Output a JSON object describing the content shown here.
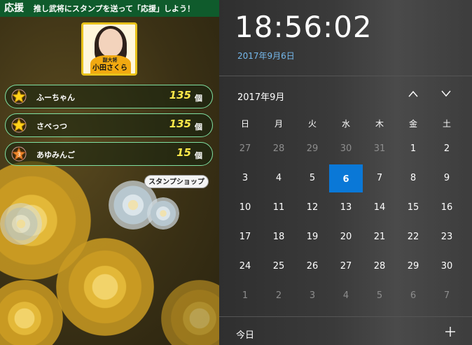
{
  "game": {
    "header_title": "応援",
    "header_subtitle": "推し武将にスタンプを送って「応援」しよう！",
    "portrait": {
      "role": "副大将",
      "name": "小田さくら"
    },
    "ranking": [
      {
        "badge": "gold-star",
        "name": "ふーちゃん",
        "count": "135",
        "unit": "個"
      },
      {
        "badge": "gold-star",
        "name": "さべっつ",
        "count": "135",
        "unit": "個"
      },
      {
        "badge": "orange-star-3",
        "name": "あゆみんご",
        "count": "15",
        "unit": "個"
      }
    ],
    "shop_button": "スタンプショップ"
  },
  "clock": {
    "time": "18:56:02",
    "date": "2017年9月6日",
    "month_label": "2017年9月",
    "weekdays": [
      "日",
      "月",
      "火",
      "水",
      "木",
      "金",
      "土"
    ],
    "weeks": [
      [
        "27",
        "28",
        "29",
        "30",
        "31",
        "1",
        "2"
      ],
      [
        "3",
        "4",
        "5",
        "6",
        "7",
        "8",
        "9"
      ],
      [
        "10",
        "11",
        "12",
        "13",
        "14",
        "15",
        "16"
      ],
      [
        "17",
        "18",
        "19",
        "20",
        "21",
        "22",
        "23"
      ],
      [
        "24",
        "25",
        "26",
        "27",
        "28",
        "29",
        "30"
      ],
      [
        "1",
        "2",
        "3",
        "4",
        "5",
        "6",
        "7"
      ]
    ],
    "dim_cells": "row0 cols0-4 and row5 all",
    "today": "6",
    "today_label": "今日",
    "accent_color": "#0a78d7",
    "link_color": "#76b9ed"
  }
}
